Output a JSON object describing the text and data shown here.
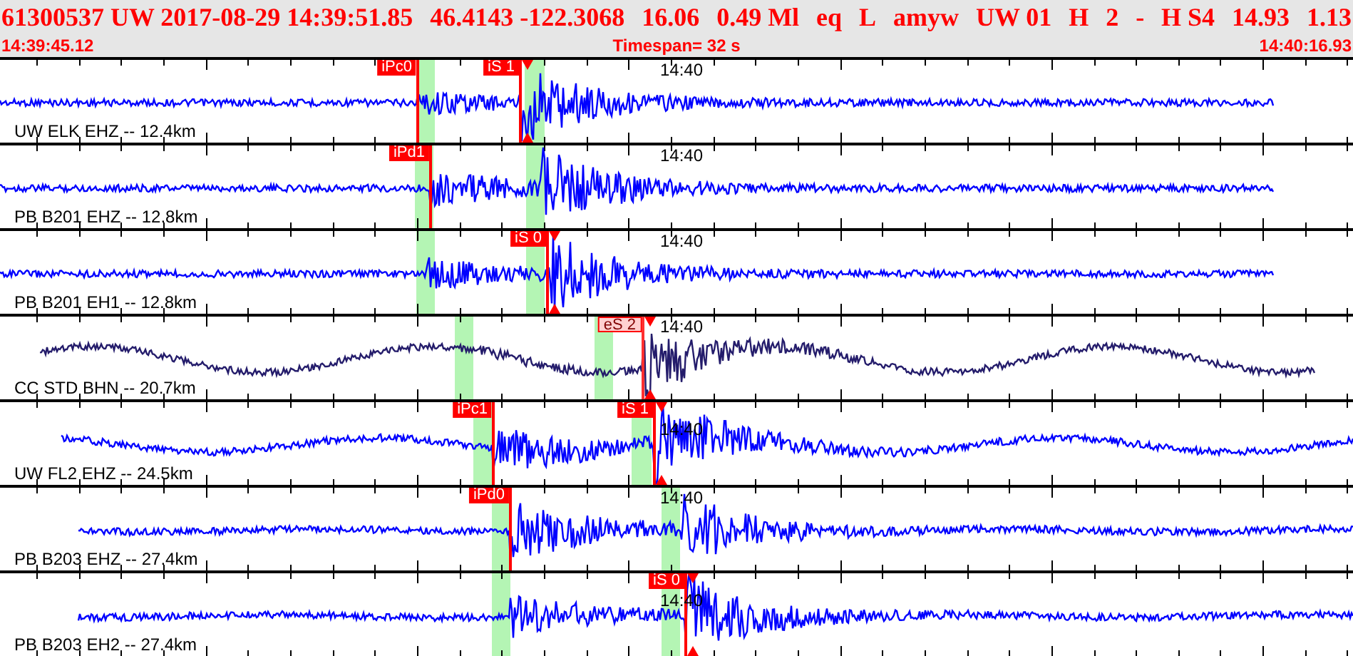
{
  "header": {
    "event_fields": [
      "61300537 UW 2017-08-29 14:39:51.85",
      "46.4143 -122.3068",
      "16.06",
      "0.49 Ml",
      "eq",
      "L",
      "amyw",
      "UW 01",
      "H",
      "2",
      "-",
      "H S4",
      "14.93",
      "1.13"
    ],
    "start_time": "14:39:45.12",
    "timespan": "Timespan=  32 s",
    "end_time": "14:40:16.93"
  },
  "panels": [
    {
      "station": "UW ELK EHZ -- 12.4km",
      "time_label": "14:40",
      "color": "#0000ff",
      "picks": [
        {
          "label": "iPc0",
          "kind": "filled",
          "flagged": false
        },
        {
          "label": "iS 1",
          "kind": "filled",
          "flagged": true
        }
      ]
    },
    {
      "station": "PB B201 EHZ -- 12.8km",
      "time_label": "14:40",
      "color": "#0000ff",
      "picks": [
        {
          "label": "iPd1",
          "kind": "filled",
          "flagged": false
        }
      ]
    },
    {
      "station": "PB B201 EH1 -- 12.8km",
      "time_label": "14:40",
      "color": "#0000ff",
      "picks": [
        {
          "label": "iS 0",
          "kind": "filled",
          "flagged": true
        }
      ]
    },
    {
      "station": "CC STD BHN -- 20.7km",
      "time_label": "14:40",
      "color": "#241c6b",
      "picks": [
        {
          "label": "eS 2",
          "kind": "outlined",
          "flagged": true
        }
      ]
    },
    {
      "station": "UW FL2 EHZ -- 24.5km",
      "time_label": "14:40",
      "color": "#0000ff",
      "picks": [
        {
          "label": "iPc1",
          "kind": "filled",
          "flagged": false
        },
        {
          "label": "iS 1",
          "kind": "filled",
          "flagged": true
        }
      ]
    },
    {
      "station": "PB B203 EHZ -- 27.4km",
      "time_label": "14:40",
      "color": "#0000ff",
      "picks": [
        {
          "label": "iPd0",
          "kind": "filled",
          "flagged": false
        }
      ]
    },
    {
      "station": "PB B203 EH2 -- 27.4km",
      "time_label": "14:40",
      "color": "#0000ff",
      "picks": [
        {
          "label": "iS 0",
          "kind": "filled",
          "flagged": true
        }
      ]
    }
  ]
}
